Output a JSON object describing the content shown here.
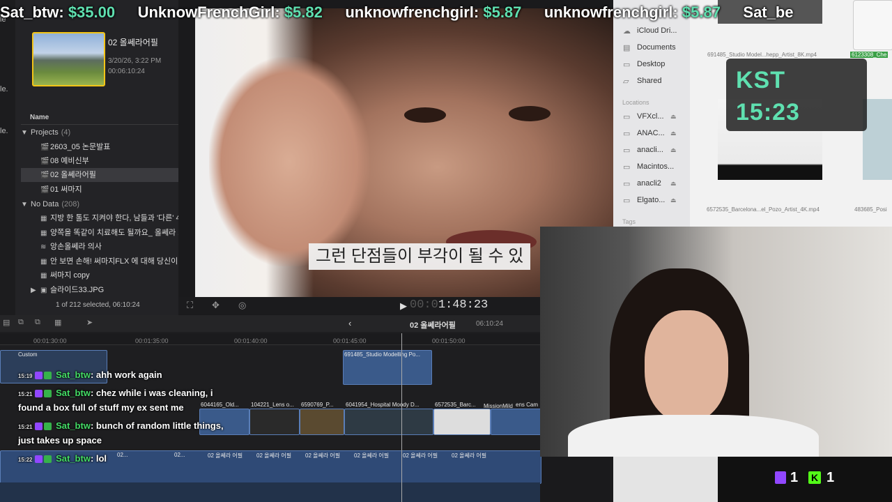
{
  "donations": [
    {
      "donor": "Sat_btw:",
      "amount": "$35.00"
    },
    {
      "donor": "UnknowFrenchGirl:",
      "amount": "$5.82"
    },
    {
      "donor": "unknowfrenchgirl:",
      "amount": "$5.87"
    },
    {
      "donor": "unknowfrenchgirl:",
      "amount": "$5.87"
    },
    {
      "donor": "Sat_be",
      "amount": ""
    }
  ],
  "browser": {
    "strip_labels": [
      "le",
      "le.",
      "le."
    ],
    "clip": {
      "name": "02 올쎄라어필",
      "date": "3/20/26, 3:22 PM",
      "duration": "00:06:10:24"
    },
    "column_name": "Name",
    "projects_label": "Projects",
    "projects_count": "(4)",
    "projects": [
      "2603_05 논문발표",
      "08 예비신부",
      "02 올쎄라어필",
      "01 써마지"
    ],
    "nodata_label": "No Data",
    "nodata_count": "(208)",
    "nodata_items": [
      "지방 한 톨도 지켜야 한다, 남들과 '다른' 4",
      "양쪽을 똑같이 치료해도 될까요_ 올쎄라 끄",
      "앙손올쎄라 의사",
      "안 보면 손해! 써마지FLX 에 대해 당신이",
      "써마지 copy",
      "슬라이드33.JPG"
    ],
    "selection_status": "1 of 212 selected, 06:10:24"
  },
  "viewer": {
    "subtitle": "그런 단점들이 부각이 될 수 있",
    "timecode_dim": "00:0",
    "timecode": "1:48:23"
  },
  "finder": {
    "sidebar": [
      "iCloud Dri...",
      "Documents",
      "Desktop",
      "Shared"
    ],
    "locations_label": "Locations",
    "locations": [
      "VFXcl...",
      "ANAC...",
      "anacli...",
      "Macintos...",
      "anacli2",
      "Elgato..."
    ],
    "tags_label": "Tags",
    "files": [
      "691485_Studio Model...hepp_Artist_8K.mp4",
      "6123308_Che",
      "6572535_Barcelona...el_Pozo_Artist_4K.mp4",
      "483685_Posi"
    ]
  },
  "clock": {
    "label": "KST",
    "time": "15:23"
  },
  "timeline": {
    "project_name": "02 올쎄라어필",
    "project_duration": "06:10:24",
    "ruler_ticks": [
      "00:01:30:00",
      "00:01:35:00",
      "00:01:40:00",
      "00:01:45:00",
      "00:01:50:00"
    ],
    "custom_label": "Custom",
    "clips_upper": [
      "691485_Studio Modelling Po..."
    ],
    "clips_lower": [
      "6044165_Old...",
      "104221_Lens o...",
      "6590769_P...",
      "6041954_Hospital Moody D...",
      "6572535_Barc...",
      "ens Cam"
    ],
    "overlay_name": "MissionMild",
    "primary_label": "02 올쎄라 어필",
    "primary_short": "02..."
  },
  "chat": [
    {
      "time": "15:19",
      "user": "Sat_btw",
      "text": ": ahh work again"
    },
    {
      "time": "15:21",
      "user": "Sat_btw",
      "text": ": chez while i was cleaning, i"
    },
    {
      "time": "",
      "user": "",
      "text": "found a box full of stuff my ex sent me"
    },
    {
      "time": "15:21",
      "user": "Sat_btw",
      "text": ": bunch of random little things,"
    },
    {
      "time": "",
      "user": "",
      "text": "just takes up space"
    },
    {
      "time": "15:22",
      "user": "Sat_btw",
      "text": ": lol"
    }
  ],
  "counters": {
    "twitch": "1",
    "kick": "1",
    "kick_letter": "K"
  },
  "colors": {
    "accent_green": "#5fe0b0",
    "chat_user": "#44dd66",
    "selection_yellow": "#f3c417",
    "clip_blue": "#3a5a8a"
  }
}
